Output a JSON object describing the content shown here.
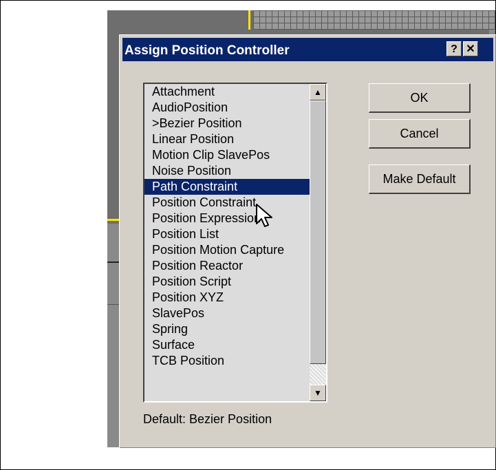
{
  "dialog": {
    "title": "Assign Position Controller",
    "help_button": "?",
    "close_button": "✕"
  },
  "list": {
    "items": [
      "Attachment",
      "AudioPosition",
      ">Bezier Position",
      "Linear Position",
      "Motion Clip SlavePos",
      "Noise Position",
      "Path Constraint",
      "Position Constraint",
      "Position Expression",
      "Position List",
      "Position Motion Capture",
      "Position Reactor",
      "Position Script",
      "Position XYZ",
      "SlavePos",
      "Spring",
      "Surface",
      "TCB Position"
    ],
    "selected": "Path Constraint"
  },
  "buttons": {
    "ok": "OK",
    "cancel": "Cancel",
    "make_default": "Make Default"
  },
  "default_label": "Default:  Bezier Position",
  "colors": {
    "titlebar": "#0a246a",
    "selection": "#0a246a",
    "dialog_face": "#d4d0c8",
    "viewport_highlight": "#ffe600"
  },
  "icons": {
    "scroll_up": "triangle-up",
    "scroll_down": "triangle-down",
    "cursor": "arrow-pointer"
  }
}
